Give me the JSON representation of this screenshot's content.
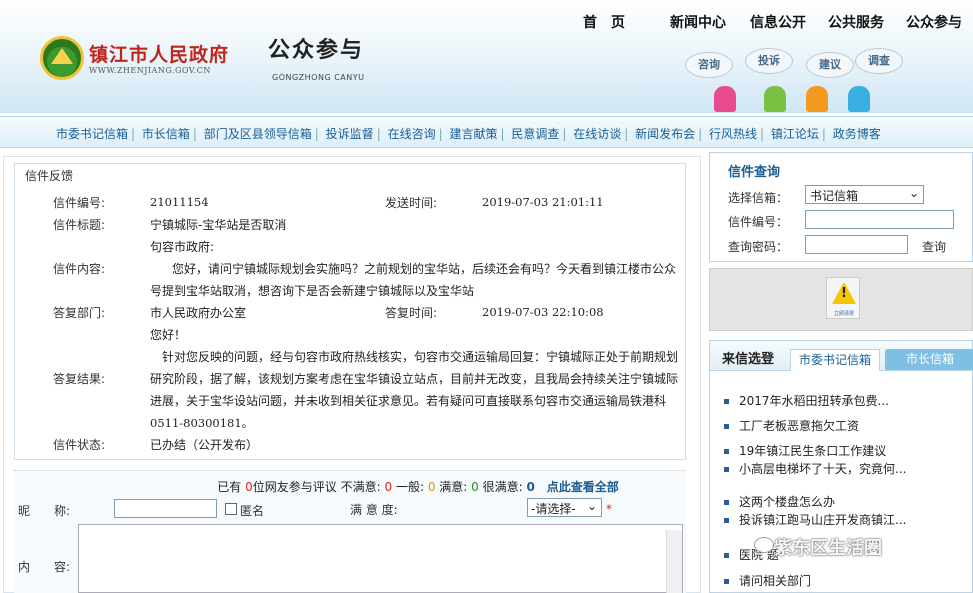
{
  "header": {
    "logo_title": "镇江市人民政府",
    "logo_url": "WWW.ZHENJIANG.GOV.CN",
    "site_title": "公众参与",
    "site_subtitle": "GONGZHONG CANYU",
    "top_nav": [
      "首　页",
      "新闻中心",
      "信息公开",
      "公共服务",
      "公众参与"
    ],
    "bubbles": [
      "咨询",
      "投诉",
      "建议",
      "调查"
    ],
    "figure_colors": [
      "#e94b8f",
      "#7ac143",
      "#f39a1e",
      "#3ab0e2"
    ]
  },
  "main_nav": [
    "市委书记信箱",
    "市长信箱",
    "部门及区县领导信箱",
    "投诉监督",
    "在线咨询",
    "建言献策",
    "民意调查",
    "在线访谈",
    "新闻发布会",
    "行风热线",
    "镇江论坛",
    "政务博客"
  ],
  "letter": {
    "panel_title": "信件反馈",
    "labels": {
      "id": "信件编号:",
      "sent_time": "发送时间:",
      "subject": "信件标题:",
      "content": "信件内容:",
      "reply_dept": "答复部门:",
      "reply_time": "答复时间:",
      "reply_result": "答复结果:",
      "status": "信件状态:"
    },
    "id": "21011154",
    "sent_time": "2019-07-03 21:01:11",
    "subject": "宁镇城际-宝华站是否取消",
    "addressee": "句容市政府:",
    "content_line1": "您好，请问宁镇城际规划会实施吗？之前规划的宝华站，后续还会有吗？今天看到镇江楼市公众",
    "content_line2": "号提到宝华站取消，想咨询下是否会新建宁镇城际以及宝华站",
    "reply_dept": "市人民政府办公室",
    "reply_time": "2019-07-03 22:10:08",
    "reply_greeting": "您好！",
    "reply_line1": "针对您反映的问题，经与句容市政府热线核实，句容市交通运输局回复：宁镇城际正处于前期规划",
    "reply_line2": "研究阶段，据了解，该规划方案考虑在宝华镇设立站点，目前并无改变，且我局会持续关注宁镇城际",
    "reply_line3": "进展，关于宝华设站问题，并未收到相关征求意见。若有疑问可直接联系句容市交通运输局铁港科",
    "reply_line4": "0511-80300181。",
    "status": "已办结（公开发布）"
  },
  "comments": {
    "prefix": "已有",
    "count": "0",
    "mid": "位网友参与评议",
    "unsat_label": "不满意:",
    "unsat": "0",
    "normal_label": "一般:",
    "normal": "0",
    "sat_label": "满意:",
    "sat": "0",
    "very_label": "很满意:",
    "very": "0",
    "view_all": "点此查看全部"
  },
  "form": {
    "nickname_label": "昵　　称:",
    "anonymous_label": "匿名",
    "satisfaction_label": "满 意 度:",
    "satisfaction_selected": "-请选择-",
    "required_mark": "*",
    "content_label": "内　　容:"
  },
  "query": {
    "title": "信件查询",
    "mailbox_label": "选择信箱：",
    "mailbox_selected": "书记信箱",
    "id_label": "信件编号：",
    "password_label": "查询密码：",
    "search_button": "查询"
  },
  "banner": {
    "caption": "立即清零"
  },
  "letters_list": {
    "title": "来信选登",
    "tab_active": "市委书记信箱",
    "tab_inactive": "市长信箱",
    "items": [
      "2017年水稻田扭转承包费...",
      "工厂老板恶意拖欠工资",
      "19年镇江民生条口工作建议",
      "小高层电梯坏了十天，究竟何...",
      "这两个楼盘怎么办",
      "投诉镇江跑马山庄开发商镇江...",
      "医院 题",
      "请问相关部门"
    ]
  },
  "watermark": "紫东区生活圈"
}
